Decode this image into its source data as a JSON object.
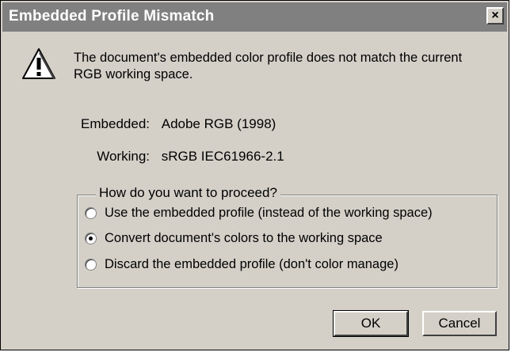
{
  "dialog": {
    "title": "Embedded Profile Mismatch",
    "close_label": "×",
    "message": "The document's embedded color profile does not match the current RGB working space.",
    "embedded_label": "Embedded:",
    "embedded_value": "Adobe RGB (1998)",
    "working_label": "Working:",
    "working_value": "sRGB IEC61966-2.1",
    "group_label": "How do you want to proceed?",
    "options": [
      {
        "label": "Use the embedded profile (instead of the working space)",
        "checked": false
      },
      {
        "label": "Convert document's colors to the working space",
        "checked": true
      },
      {
        "label": "Discard the embedded profile (don't color manage)",
        "checked": false
      }
    ],
    "ok_label": "OK",
    "cancel_label": "Cancel"
  },
  "icons": {
    "warning": "warning-icon",
    "close": "close-icon"
  },
  "colors": {
    "dialog_bg": "#d4d0c8",
    "titlebar_bg": "#808080",
    "icon_fill": "#ffffff"
  }
}
